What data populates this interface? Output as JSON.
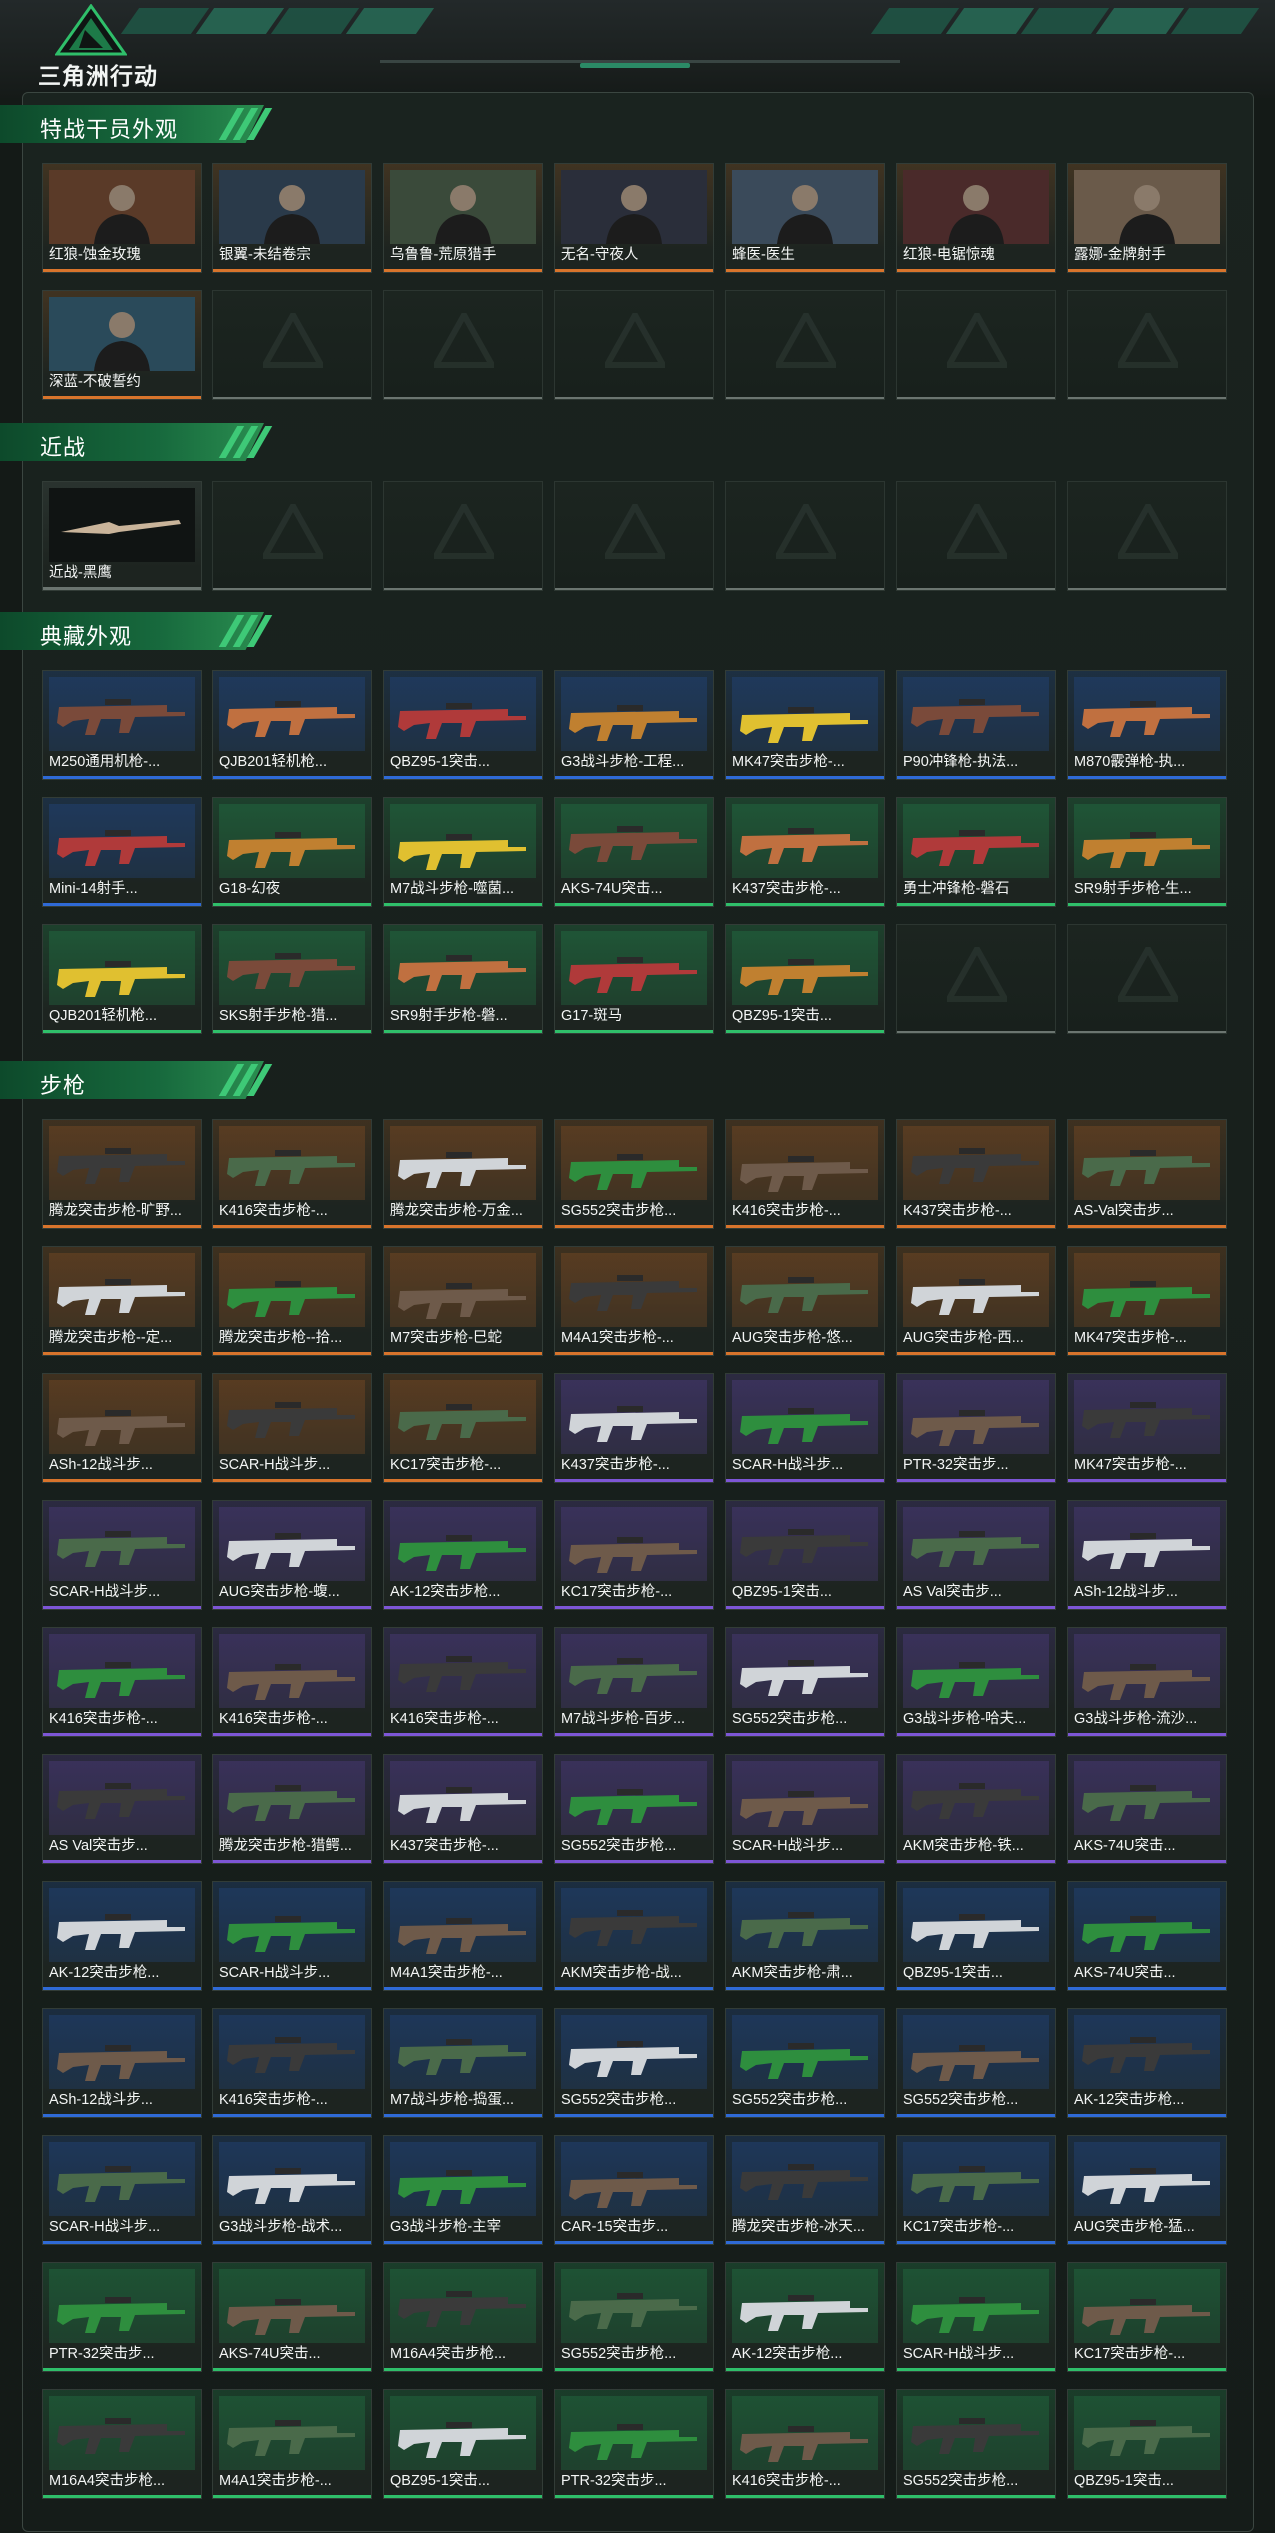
{
  "header": {
    "logo_text": "三角洲行动"
  },
  "colors": {
    "accent": "#2fbf6a",
    "section_bar": "#17693d",
    "bg": "#141a17"
  },
  "rarity_colors": {
    "orange": "#d8742c",
    "purple": "#7d56d6",
    "blue": "#2f6ad6",
    "green": "#2fbf6a",
    "gray": "#6b7570"
  },
  "sections": [
    {
      "title": "特战干员外观",
      "items": [
        {
          "name": "红狼-蚀金玫瑰",
          "rarity": "orange",
          "tag": "蚀金玫瑰"
        },
        {
          "name": "银翼-未结卷宗",
          "rarity": "orange",
          "tag": "未结卷宗"
        },
        {
          "name": "乌鲁鲁-荒原猎手",
          "rarity": "orange",
          "tag": "荒原猎手"
        },
        {
          "name": "无名-守夜人",
          "rarity": "orange",
          "tag": "守夜人"
        },
        {
          "name": "蜂医-医生",
          "rarity": "orange",
          "tag": "医生"
        },
        {
          "name": "红狼-电锯惊魂",
          "rarity": "orange",
          "tag": "电锯惊魂"
        },
        {
          "name": "露娜-金牌射手",
          "rarity": "orange",
          "tag": ""
        },
        {
          "name": "深蓝-不破誓约",
          "rarity": "orange",
          "tag": "不破誓约"
        }
      ]
    },
    {
      "title": "近战",
      "items": [
        {
          "name": "近战-黑鹰",
          "rarity": "gray"
        }
      ]
    },
    {
      "title": "典藏外观",
      "items": [
        {
          "name": "M250通用机枪-...",
          "rarity": "blue"
        },
        {
          "name": "QJB201轻机枪...",
          "rarity": "blue"
        },
        {
          "name": "QBZ95-1突击...",
          "rarity": "blue"
        },
        {
          "name": "G3战斗步枪-工程...",
          "rarity": "blue"
        },
        {
          "name": "MK47突击步枪-...",
          "rarity": "blue"
        },
        {
          "name": "P90冲锋枪-执法...",
          "rarity": "blue"
        },
        {
          "name": "M870霰弹枪-执...",
          "rarity": "blue"
        },
        {
          "name": "Mini-14射手...",
          "rarity": "blue"
        },
        {
          "name": "G18-幻夜",
          "rarity": "green"
        },
        {
          "name": "M7战斗步枪-噬菌...",
          "rarity": "green"
        },
        {
          "name": "AKS-74U突击...",
          "rarity": "green"
        },
        {
          "name": "K437突击步枪-...",
          "rarity": "green"
        },
        {
          "name": "勇士冲锋枪-磐石",
          "rarity": "green"
        },
        {
          "name": "SR9射手步枪-生...",
          "rarity": "green"
        },
        {
          "name": "QJB201轻机枪...",
          "rarity": "green"
        },
        {
          "name": "SKS射手步枪-猎...",
          "rarity": "green"
        },
        {
          "name": "SR9射手步枪-磐...",
          "rarity": "green"
        },
        {
          "name": "G17-斑马",
          "rarity": "green"
        },
        {
          "name": "QBZ95-1突击...",
          "rarity": "green"
        }
      ]
    },
    {
      "title": "步枪",
      "items": [
        {
          "name": "腾龙突击步枪-旷野...",
          "rarity": "orange"
        },
        {
          "name": "K416突击步枪-...",
          "rarity": "orange"
        },
        {
          "name": "腾龙突击步枪-万金...",
          "rarity": "orange"
        },
        {
          "name": "SG552突击步枪...",
          "rarity": "orange"
        },
        {
          "name": "K416突击步枪-...",
          "rarity": "orange"
        },
        {
          "name": "K437突击步枪-...",
          "rarity": "orange"
        },
        {
          "name": "AS-Val突击步...",
          "rarity": "orange"
        },
        {
          "name": "腾龙突击步枪--定...",
          "rarity": "orange"
        },
        {
          "name": "腾龙突击步枪--拾...",
          "rarity": "orange"
        },
        {
          "name": "M7突击步枪-巳蛇",
          "rarity": "orange"
        },
        {
          "name": "M4A1突击步枪-...",
          "rarity": "orange"
        },
        {
          "name": "AUG突击步枪-悠...",
          "rarity": "orange"
        },
        {
          "name": "AUG突击步枪-西...",
          "rarity": "orange"
        },
        {
          "name": "MK47突击步枪-...",
          "rarity": "orange"
        },
        {
          "name": "ASh-12战斗步...",
          "rarity": "orange"
        },
        {
          "name": "SCAR-H战斗步...",
          "rarity": "orange"
        },
        {
          "name": "KC17突击步枪-...",
          "rarity": "orange"
        },
        {
          "name": "K437突击步枪-...",
          "rarity": "purple"
        },
        {
          "name": "SCAR-H战斗步...",
          "rarity": "purple"
        },
        {
          "name": "PTR-32突击步...",
          "rarity": "purple"
        },
        {
          "name": "MK47突击步枪-...",
          "rarity": "purple"
        },
        {
          "name": "SCAR-H战斗步...",
          "rarity": "purple"
        },
        {
          "name": "AUG突击步枪-蝮...",
          "rarity": "purple"
        },
        {
          "name": "AK-12突击步枪...",
          "rarity": "purple"
        },
        {
          "name": "KC17突击步枪-...",
          "rarity": "purple"
        },
        {
          "name": "QBZ95-1突击...",
          "rarity": "purple"
        },
        {
          "name": "AS Val突击步...",
          "rarity": "purple"
        },
        {
          "name": "ASh-12战斗步...",
          "rarity": "purple"
        },
        {
          "name": "K416突击步枪-...",
          "rarity": "purple"
        },
        {
          "name": "K416突击步枪-...",
          "rarity": "purple"
        },
        {
          "name": "K416突击步枪-...",
          "rarity": "purple"
        },
        {
          "name": "M7战斗步枪-百步...",
          "rarity": "purple"
        },
        {
          "name": "SG552突击步枪...",
          "rarity": "purple"
        },
        {
          "name": "G3战斗步枪-哈夫...",
          "rarity": "purple"
        },
        {
          "name": "G3战斗步枪-流沙...",
          "rarity": "purple"
        },
        {
          "name": "AS Val突击步...",
          "rarity": "purple"
        },
        {
          "name": "腾龙突击步枪-猎鳄...",
          "rarity": "purple"
        },
        {
          "name": "K437突击步枪-...",
          "rarity": "purple"
        },
        {
          "name": "SG552突击步枪...",
          "rarity": "purple"
        },
        {
          "name": "SCAR-H战斗步...",
          "rarity": "purple"
        },
        {
          "name": "AKM突击步枪-铁...",
          "rarity": "purple"
        },
        {
          "name": "AKS-74U突击...",
          "rarity": "purple"
        },
        {
          "name": "AK-12突击步枪...",
          "rarity": "blue"
        },
        {
          "name": "SCAR-H战斗步...",
          "rarity": "blue"
        },
        {
          "name": "M4A1突击步枪-...",
          "rarity": "blue"
        },
        {
          "name": "AKM突击步枪-战...",
          "rarity": "blue"
        },
        {
          "name": "AKM突击步枪-肃...",
          "rarity": "blue"
        },
        {
          "name": "QBZ95-1突击...",
          "rarity": "blue"
        },
        {
          "name": "AKS-74U突击...",
          "rarity": "blue"
        },
        {
          "name": "ASh-12战斗步...",
          "rarity": "blue"
        },
        {
          "name": "K416突击步枪-...",
          "rarity": "blue"
        },
        {
          "name": "M7战斗步枪-捣蛋...",
          "rarity": "blue"
        },
        {
          "name": "SG552突击步枪...",
          "rarity": "blue"
        },
        {
          "name": "SG552突击步枪...",
          "rarity": "blue"
        },
        {
          "name": "SG552突击步枪...",
          "rarity": "blue"
        },
        {
          "name": "AK-12突击步枪...",
          "rarity": "blue"
        },
        {
          "name": "SCAR-H战斗步...",
          "rarity": "blue"
        },
        {
          "name": "G3战斗步枪-战术...",
          "rarity": "blue"
        },
        {
          "name": "G3战斗步枪-主宰",
          "rarity": "blue"
        },
        {
          "name": "CAR-15突击步...",
          "rarity": "blue"
        },
        {
          "name": "腾龙突击步枪-冰天...",
          "rarity": "blue"
        },
        {
          "name": "KC17突击步枪-...",
          "rarity": "blue"
        },
        {
          "name": "AUG突击步枪-猛...",
          "rarity": "blue"
        },
        {
          "name": "PTR-32突击步...",
          "rarity": "green"
        },
        {
          "name": "AKS-74U突击...",
          "rarity": "green"
        },
        {
          "name": "M16A4突击步枪...",
          "rarity": "green"
        },
        {
          "name": "SG552突击步枪...",
          "rarity": "green"
        },
        {
          "name": "AK-12突击步枪...",
          "rarity": "green"
        },
        {
          "name": "SCAR-H战斗步...",
          "rarity": "green"
        },
        {
          "name": "KC17突击步枪-...",
          "rarity": "green"
        },
        {
          "name": "M16A4突击步枪...",
          "rarity": "green"
        },
        {
          "name": "M4A1突击步枪-...",
          "rarity": "green"
        },
        {
          "name": "QBZ95-1突击...",
          "rarity": "green"
        },
        {
          "name": "PTR-32突击步...",
          "rarity": "green"
        },
        {
          "name": "K416突击步枪-...",
          "rarity": "green"
        },
        {
          "name": "SG552突击步枪...",
          "rarity": "green"
        },
        {
          "name": "QBZ95-1突击...",
          "rarity": "green"
        }
      ]
    }
  ]
}
